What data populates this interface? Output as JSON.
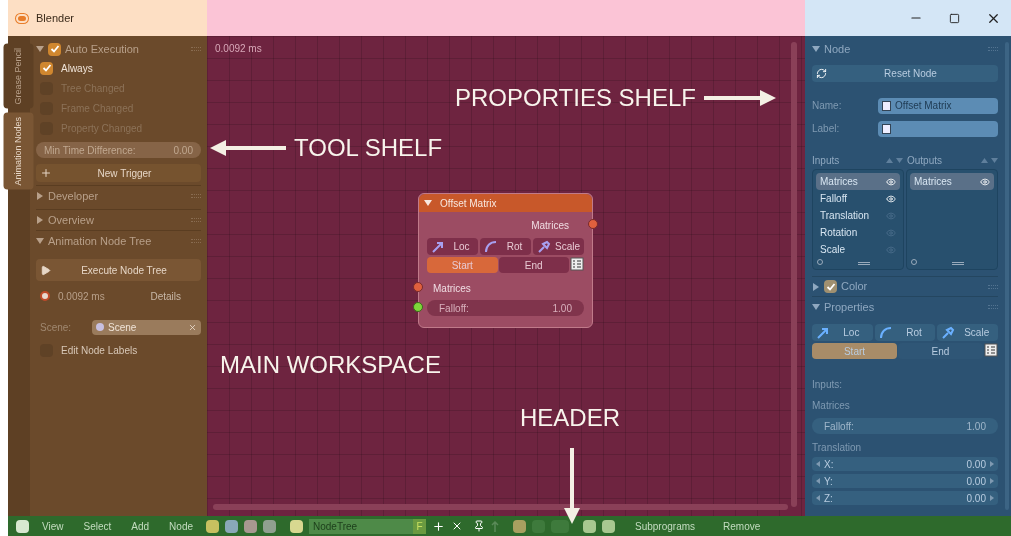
{
  "window": {
    "title": "Blender"
  },
  "tool_shelf": {
    "tabs": [
      {
        "label": "Grease Pencil",
        "selected": false
      },
      {
        "label": "Animation Nodes",
        "selected": true
      }
    ],
    "auto_execution": {
      "title": "Auto Execution",
      "expanded": true,
      "checked": true,
      "options": [
        {
          "label": "Always",
          "checked": true,
          "disabled": false
        },
        {
          "label": "Tree Changed",
          "checked": false,
          "disabled": true
        },
        {
          "label": "Frame Changed",
          "checked": false,
          "disabled": true
        },
        {
          "label": "Property Changed",
          "checked": false,
          "disabled": true
        }
      ],
      "min_time": {
        "label": "Min Time Difference:",
        "value": "0.00"
      },
      "new_trigger": "New Trigger"
    },
    "collapsed_panels": [
      {
        "title": "Developer",
        "expanded": false
      },
      {
        "title": "Overview",
        "expanded": false
      }
    ],
    "node_tree": {
      "title": "Animation Node Tree",
      "expanded": true,
      "execute": "Execute Node Tree",
      "time": "0.0092 ms",
      "details": "Details",
      "scene_label": "Scene:",
      "scene": "Scene",
      "edit_labels": {
        "label": "Edit Node Labels",
        "checked": false
      }
    }
  },
  "workspace": {
    "timing": "0.0092 ms",
    "node": {
      "title": "Offset Matrix",
      "output": "Matrices",
      "modes": [
        "Loc",
        "Rot",
        "Scale"
      ],
      "range": [
        {
          "label": "Start",
          "selected": true
        },
        {
          "label": "End",
          "selected": false
        }
      ],
      "input": "Matrices",
      "falloff": {
        "label": "Falloff:",
        "value": "1.00"
      }
    }
  },
  "properties_shelf": {
    "node_panel": {
      "title": "Node",
      "expanded": true,
      "reset": "Reset Node",
      "name_label": "Name:",
      "name": "Offset Matrix",
      "label_label": "Label:",
      "inputs_title": "Inputs",
      "outputs_title": "Outputs",
      "inputs": [
        {
          "name": "Matrices",
          "selected": true,
          "visible": true
        },
        {
          "name": "Falloff",
          "selected": false,
          "visible": true
        },
        {
          "name": "Translation",
          "selected": false,
          "visible": false
        },
        {
          "name": "Rotation",
          "selected": false,
          "visible": false
        },
        {
          "name": "Scale",
          "selected": false,
          "visible": false
        }
      ],
      "outputs": [
        {
          "name": "Matrices",
          "selected": true,
          "visible": true
        }
      ]
    },
    "color_panel": {
      "title": "Color",
      "expanded": false,
      "checked": true
    },
    "properties_panel": {
      "title": "Properties",
      "expanded": true,
      "modes": [
        "Loc",
        "Rot",
        "Scale"
      ],
      "range": [
        {
          "label": "Start",
          "selected": true
        },
        {
          "label": "End",
          "selected": false
        }
      ],
      "inputs_label": "Inputs:",
      "matrices": "Matrices",
      "falloff": {
        "label": "Falloff:",
        "value": "1.00"
      },
      "translation": "Translation",
      "vector": [
        {
          "axis": "X:",
          "value": "0.00"
        },
        {
          "axis": "Y:",
          "value": "0.00"
        },
        {
          "axis": "Z:",
          "value": "0.00"
        }
      ]
    }
  },
  "header": {
    "menus": [
      "View",
      "Select",
      "Add",
      "Node"
    ],
    "tree_name": "NodeTree",
    "fake_user": "F",
    "buttons": [
      "Subprograms",
      "Remove"
    ]
  },
  "annotations": [
    {
      "text": "PROPORTIES SHELF",
      "kind": "right"
    },
    {
      "text": "TOOL SHELF",
      "kind": "left"
    },
    {
      "text": "MAIN WORKSPACE",
      "kind": "plain"
    },
    {
      "text": "HEADER",
      "kind": "down"
    }
  ]
}
